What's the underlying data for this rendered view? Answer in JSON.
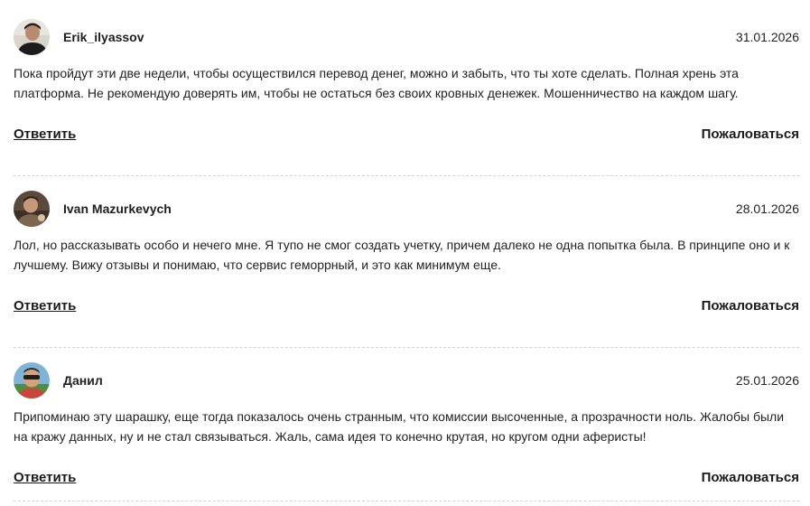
{
  "comments": [
    {
      "author": "Erik_ilyassov",
      "date": "31.01.2026",
      "text": "Пока пройдут эти две недели, чтобы осуществился перевод денег, можно и забыть, что ты хоте сделать. Полная хрень эта платформа. Не рекомендую доверять им, чтобы не остаться без своих кровных денежек. Мошенничество на каждом шагу.",
      "reply_label": "Ответить",
      "report_label": "Пожаловаться"
    },
    {
      "author": "Ivan Mazurkevych",
      "date": "28.01.2026",
      "text": "Лол, но рассказывать особо и нечего мне. Я тупо не смог создать учетку, причем далеко не одна попытка была. В принципе оно и к лучшему. Вижу отзывы и понимаю, что сервис геморрный, и это как минимум еще.",
      "reply_label": "Ответить",
      "report_label": "Пожаловаться"
    },
    {
      "author": "Данил",
      "date": "25.01.2026",
      "text": "Припоминаю эту шарашку, еще тогда показалось очень странным, что комиссии высоченные, а прозрачности ноль. Жалобы были на кражу данных, ну и не стал связываться. Жаль, сама идея то конечно крутая, но кругом одни аферисты!",
      "reply_label": "Ответить",
      "report_label": "Пожаловаться"
    }
  ]
}
